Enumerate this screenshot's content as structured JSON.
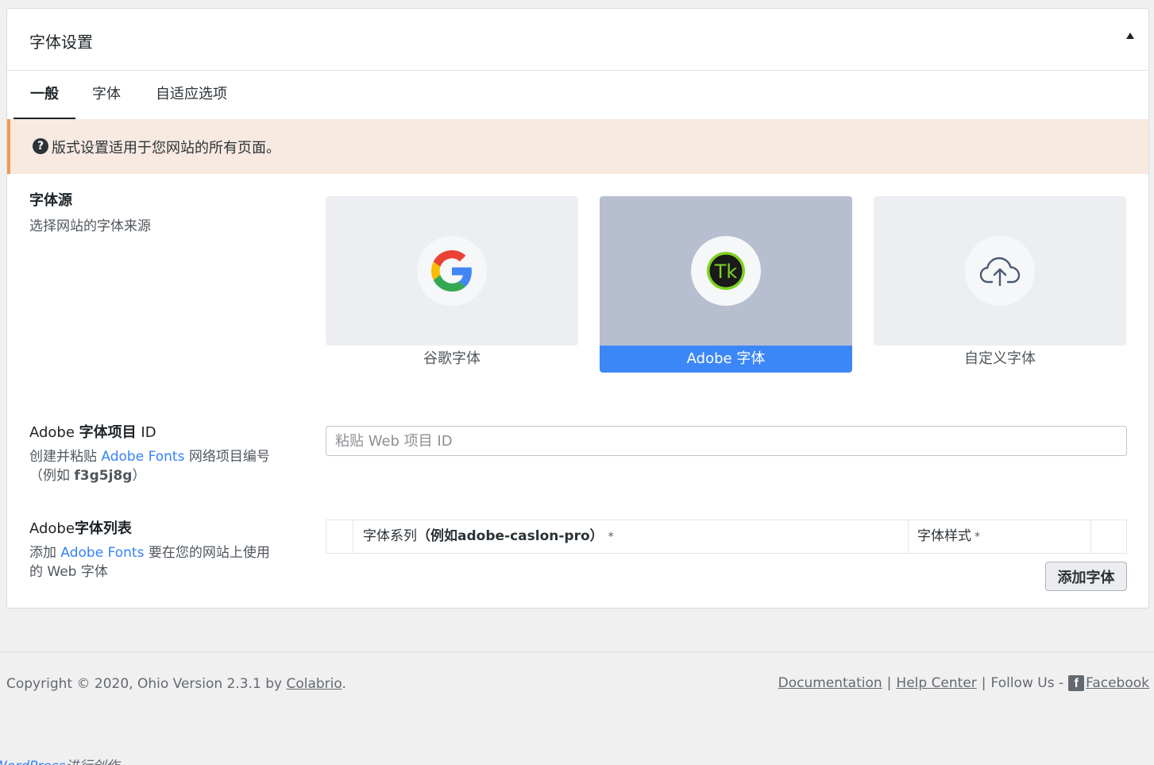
{
  "panel": {
    "title": "字体设置"
  },
  "tabs": [
    {
      "label": "一般"
    },
    {
      "label": "字体"
    },
    {
      "label": "自适应选项"
    }
  ],
  "notice": {
    "icon": "question-circle-icon",
    "text": "版式设置适用于您网站的所有页面。"
  },
  "font_source": {
    "title": "字体源",
    "description": "选择网站的字体来源",
    "options": [
      {
        "label": "谷歌字体",
        "icon": "google-icon",
        "selected": false
      },
      {
        "label": "Adobe 字体",
        "icon": "typekit-icon",
        "icon_text": "Tk",
        "selected": true
      },
      {
        "label": "自定义字体",
        "icon": "cloud-upload-icon",
        "selected": false
      }
    ]
  },
  "project_id": {
    "title_prefix": "Adobe ",
    "title_main": "字体项目",
    "title_suffix": " ID",
    "desc_before": "创建并粘贴 ",
    "desc_link": "Adobe Fonts",
    "desc_after": " 网络项目编号",
    "example_open": "（例如 ",
    "example_code": "f3g5j8g",
    "example_close": "）",
    "placeholder": "粘贴 Web 项目 ID",
    "value": ""
  },
  "font_list": {
    "title_prefix": "Adobe",
    "title_main": "字体列表",
    "desc_before": "添加 ",
    "desc_link": "Adobe Fonts",
    "desc_after": " 要在您的网站上使用",
    "desc_line2": "的 Web 字体",
    "columns": {
      "family_label": "字体系列",
      "family_example": "（例如adobe-caslon-pro）",
      "style_label": "字体样式",
      "required_mark": "*"
    },
    "add_button": "添加字体"
  },
  "footer": {
    "copyright": "Copyright © 2020, Ohio Version 2.3.1 by ",
    "author_link": "Colabrio",
    "period": ".",
    "links": {
      "documentation": "Documentation",
      "help_center": "Help Center",
      "follow_us": "Follow Us -",
      "facebook": "Facebook"
    },
    "separator": "|"
  },
  "wp_credit": {
    "link": "WordPress",
    "text": "进行创作"
  },
  "colors": {
    "accent_blue": "#3c87f7",
    "notice_bg": "#f8e9e1",
    "notice_border": "#f19a4e",
    "selected_card": "#b6becf",
    "typekit_green": "#7ed321"
  }
}
